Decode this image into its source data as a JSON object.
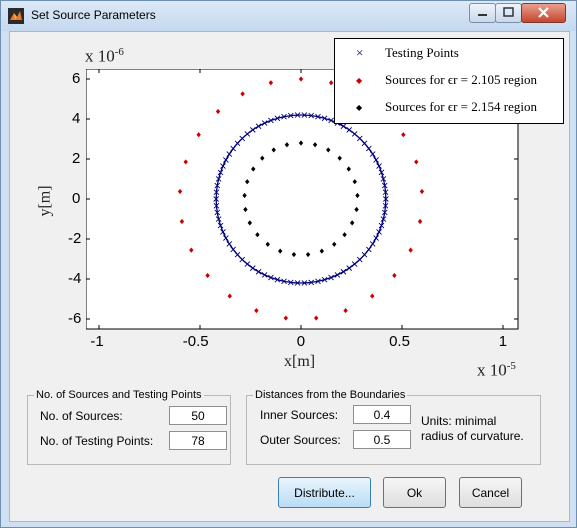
{
  "window": {
    "title": "Set Source Parameters"
  },
  "plot": {
    "x_exponent_label": "x 10",
    "x_exponent_power": "-5",
    "y_exponent_label": "x 10",
    "y_exponent_power": "-6",
    "xlabel": "x[m]",
    "ylabel": "y[m]",
    "x_ticks": [
      "-1",
      "-0.5",
      "0",
      "0.5",
      "1"
    ],
    "y_ticks": [
      "6",
      "4",
      "2",
      "0",
      "-2",
      "-4",
      "-6"
    ],
    "legend": [
      {
        "marker": "×",
        "label": "Testing  Points",
        "color": "#00007a"
      },
      {
        "marker": "◆",
        "label": "Sources for ϵr = 2.105 region",
        "color": "#cc0000"
      },
      {
        "marker": "◆",
        "label": "Sources for ϵr = 2.154 region",
        "color": "#000000"
      }
    ]
  },
  "chart_data": {
    "type": "scatter",
    "xlabel": "x[m]",
    "ylabel": "y[m]",
    "xlim": [
      -1e-05,
      1.1e-05
    ],
    "ylim": [
      -6.4e-06,
      6.4e-06
    ],
    "grid": false,
    "legend_position": "top-right",
    "series": [
      {
        "name": "Testing  Points",
        "marker": "x",
        "color": "#00007a",
        "shape": "circle",
        "center": [
          0,
          0
        ],
        "radius": 4.2e-06,
        "count": 78
      },
      {
        "name": "Sources for ϵr = 2.105 region",
        "marker": "diamond",
        "color": "#cc0000",
        "shape": "circle",
        "center": [
          0,
          0
        ],
        "radius": 6e-06,
        "count": 50
      },
      {
        "name": "Sources for ϵr = 2.154 region",
        "marker": "diamond",
        "color": "#000000",
        "shape": "circle",
        "center": [
          0,
          0
        ],
        "radius": 2.8e-06,
        "count": 50
      }
    ]
  },
  "sources_group": {
    "title": "No. of Sources and Testing Points",
    "num_sources_label": "No. of Sources:",
    "num_sources_value": "50",
    "num_testing_label": "No. of Testing Points:",
    "num_testing_value": "78"
  },
  "distances_group": {
    "title": "Distances from the Boundaries",
    "inner_label": "Inner Sources:",
    "inner_value": "0.4",
    "outer_label": "Outer Sources:",
    "outer_value": "0.5",
    "units_line1": "Units: minimal",
    "units_line2": "radius of curvature."
  },
  "buttons": {
    "distribute": "Distribute...",
    "ok": "Ok",
    "cancel": "Cancel"
  }
}
